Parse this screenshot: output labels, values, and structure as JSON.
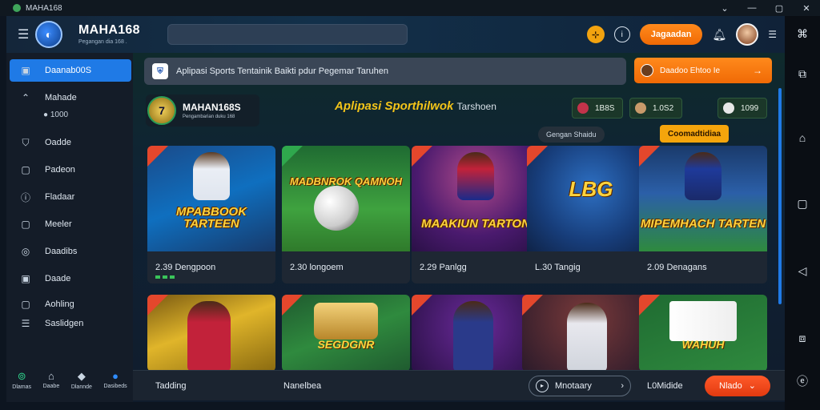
{
  "window": {
    "title": "MAHA168",
    "controls": [
      "⌄",
      "—",
      "▢",
      "✕"
    ]
  },
  "topbar": {
    "brand_name": "MAHA168",
    "brand_tagline": "Pegangan dia 168 .",
    "search_placeholder": "",
    "coin_icon": "coin-icon",
    "signup_label": "Jagaadan"
  },
  "sidebar": {
    "items": [
      {
        "label": "Daanab00S",
        "icon": "square-icon",
        "active": true
      },
      {
        "label": "Mahade",
        "icon": "chevron-up-icon",
        "sub": "1000"
      },
      {
        "label": "Oadde",
        "icon": "shield-icon"
      },
      {
        "label": "Padeon",
        "icon": "square-icon"
      },
      {
        "label": "Fladaar",
        "icon": "info-icon"
      },
      {
        "label": "Meeler",
        "icon": "square-icon"
      },
      {
        "label": "Daadibs",
        "icon": "circle-icon"
      },
      {
        "label": "Daade",
        "icon": "square-icon"
      },
      {
        "label": "Aohling",
        "icon": "square-icon"
      },
      {
        "label": "Saslidgen",
        "icon": "sliders-icon"
      }
    ],
    "bottom": [
      {
        "label": "Dlamas",
        "icon": "location-icon"
      },
      {
        "label": "Daabe",
        "icon": "home-icon"
      },
      {
        "label": "Dlannde",
        "icon": "diamond-icon"
      },
      {
        "label": "Dasibeds",
        "icon": "fire-icon"
      }
    ]
  },
  "notice": {
    "text": "Aplipasi Sports Tentainik Baikti pdur Pegemar Taruhen"
  },
  "promo": {
    "label": "Daadoo Ehtoo Ie"
  },
  "banner": {
    "logo_name": "MAHAN168S",
    "logo_tag": "Pengambarian duku 168",
    "headline": "Aplipasi Sporthilwok",
    "headline_suffix": "Tarshoen",
    "stats": [
      "1B8S",
      "1.0S2",
      "1099"
    ],
    "tag_grey": "Gengan Shaidu",
    "tag_orange": "Coomadtidiaa"
  },
  "cards": [
    {
      "title": "MPABBOOK TARTEEN",
      "meta": "2.39 Dengpoon"
    },
    {
      "title": "MADBNROK QAMNOH",
      "meta": "2.30 longoem"
    },
    {
      "title": "MAAKIUN TARTON",
      "meta": "2.29 Panlgg"
    },
    {
      "title": "LBG",
      "meta": "L.30 Tangig"
    },
    {
      "title": "MIPEMHACH TARTEN",
      "meta": "2.09 Denagans"
    }
  ],
  "cards_row2": [
    {
      "title": ""
    },
    {
      "title": "SEGDGNR"
    },
    {
      "title": ""
    },
    {
      "title": ""
    },
    {
      "title": "WAHUH"
    }
  ],
  "bottombar": {
    "left": "Tadding",
    "mid": "Nanelbea",
    "pill": "Mnotaary",
    "right": "L0Midide",
    "button": "Nlado"
  },
  "colors": {
    "accent": "#1f7ae6",
    "orange": "#f06a05",
    "gold": "#f3c419"
  }
}
